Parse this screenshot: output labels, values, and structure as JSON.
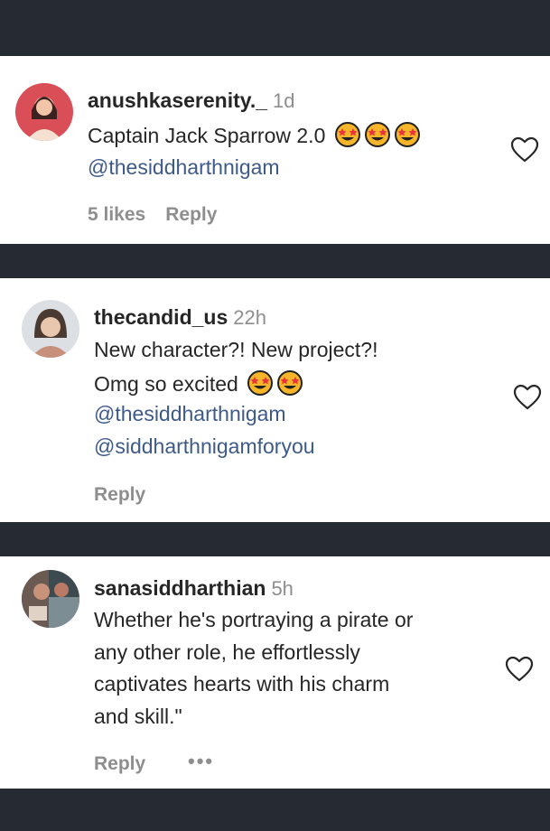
{
  "comments": [
    {
      "username": "anushkaserenity._",
      "time": "1d",
      "lines": [
        "Captain Jack Sparrow 2.0"
      ],
      "emoji": [
        "star-struck-emoji",
        "star-struck-emoji",
        "star-struck-emoji"
      ],
      "mentions": [
        "@thesiddharthnigam"
      ],
      "likes": "5 likes",
      "reply": "Reply"
    },
    {
      "username": "thecandid_us",
      "time": "22h",
      "lines": [
        "New character?! New project?!",
        "Omg so excited"
      ],
      "emoji": [
        "star-struck-emoji",
        "star-struck-emoji"
      ],
      "mentions": [
        "@thesiddharthnigam",
        "@siddharthnigamforyou"
      ],
      "reply": "Reply"
    },
    {
      "username": "sanasiddharthian",
      "time": "5h",
      "lines": [
        "Whether he's portraying a pirate or",
        "any other role, he effortlessly",
        "captivates hearts with his charm",
        "and skill.\""
      ],
      "reply": "Reply",
      "more": "•••"
    }
  ],
  "icons": {
    "like": "heart-outline-icon",
    "more": "more-options-icon"
  },
  "colors": {
    "background": "#262a33",
    "card": "#ffffff",
    "text": "#262626",
    "muted": "#8e8e8e",
    "mention": "#3d5a8a",
    "emoji": "#f7b52a"
  }
}
